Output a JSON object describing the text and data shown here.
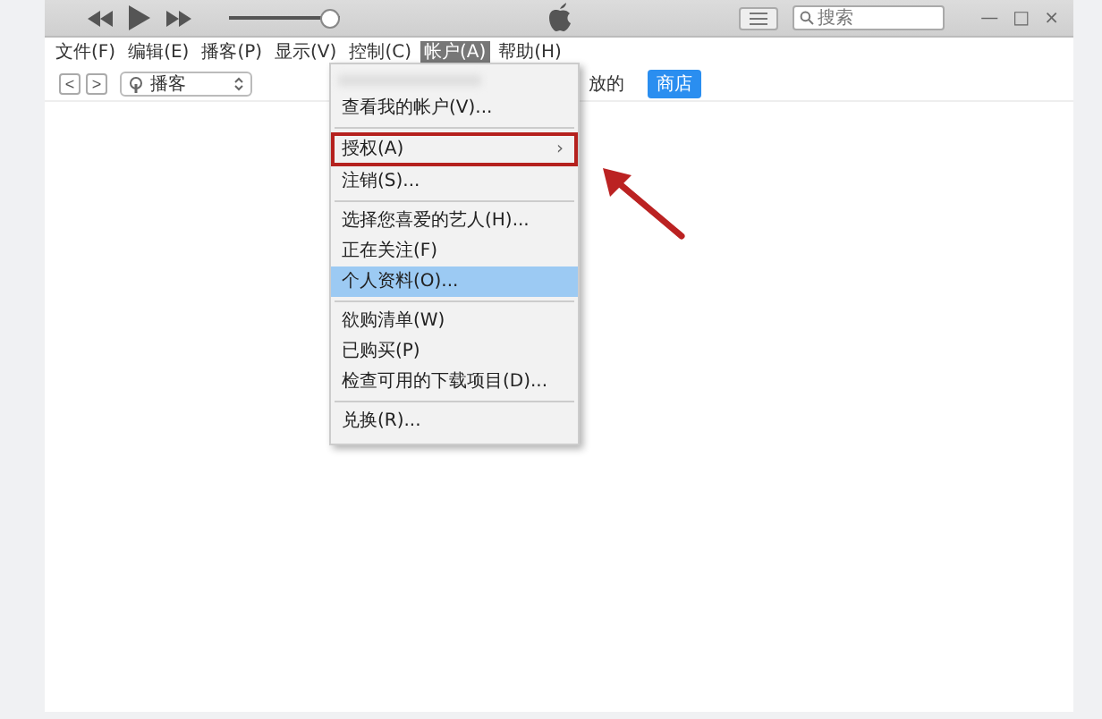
{
  "toolbar": {
    "volume": {
      "level": 1
    },
    "search": {
      "placeholder": "搜索"
    },
    "window_controls": [
      "—",
      "□",
      "×"
    ]
  },
  "menu_bar": [
    {
      "label": "文件(F)",
      "selected": false
    },
    {
      "label": "编辑(E)",
      "selected": false
    },
    {
      "label": "播客(P)",
      "selected": false
    },
    {
      "label": "显示(V)",
      "selected": false
    },
    {
      "label": "控制(C)",
      "selected": false
    },
    {
      "label": "帐户(A)",
      "selected": true
    },
    {
      "label": "帮助(H)",
      "selected": false
    }
  ],
  "nav": {
    "back": "<",
    "forward": ">",
    "source": "播客",
    "tabs": [
      {
        "label": "放的",
        "selected": false
      },
      {
        "label": "商店",
        "selected": true
      }
    ]
  },
  "account_menu": {
    "items": [
      {
        "kind": "item",
        "label": "查看我的帐户(V)...",
        "selected": false,
        "highlighted": false
      },
      {
        "kind": "separator"
      },
      {
        "kind": "submenu",
        "label": "授权(A)",
        "arrow": "›",
        "selected": false,
        "highlighted": true
      },
      {
        "kind": "item",
        "label": "注销(S)...",
        "selected": false,
        "highlighted": false
      },
      {
        "kind": "separator"
      },
      {
        "kind": "item",
        "label": "选择您喜爱的艺人(H)...",
        "selected": false,
        "highlighted": false
      },
      {
        "kind": "item",
        "label": "正在关注(F)",
        "selected": false,
        "highlighted": false
      },
      {
        "kind": "item",
        "label": "个人资料(O)...",
        "selected": true,
        "highlighted": false
      },
      {
        "kind": "separator"
      },
      {
        "kind": "item",
        "label": "欲购清单(W)",
        "selected": false,
        "highlighted": false
      },
      {
        "kind": "item",
        "label": "已购买(P)",
        "selected": false,
        "highlighted": false
      },
      {
        "kind": "item",
        "label": "检查可用的下载项目(D)...",
        "selected": false,
        "highlighted": false
      },
      {
        "kind": "separator"
      },
      {
        "kind": "item",
        "label": "兑换(R)...",
        "selected": false,
        "highlighted": false
      }
    ]
  }
}
